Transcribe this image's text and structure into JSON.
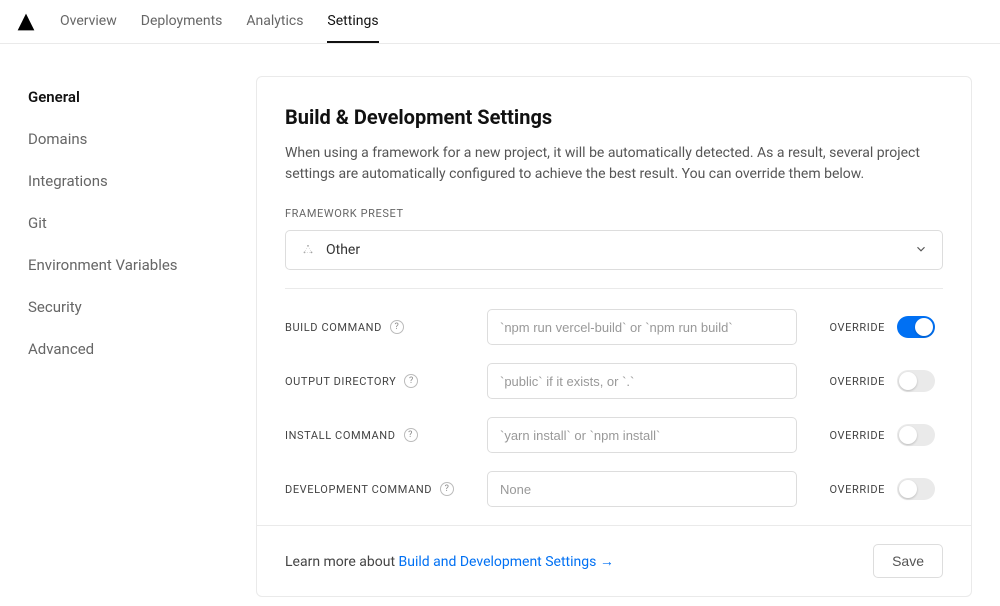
{
  "nav": {
    "items": [
      {
        "label": "Overview"
      },
      {
        "label": "Deployments"
      },
      {
        "label": "Analytics"
      },
      {
        "label": "Settings"
      }
    ],
    "active_index": 3
  },
  "sidebar": {
    "items": [
      {
        "label": "General"
      },
      {
        "label": "Domains"
      },
      {
        "label": "Integrations"
      },
      {
        "label": "Git"
      },
      {
        "label": "Environment Variables"
      },
      {
        "label": "Security"
      },
      {
        "label": "Advanced"
      }
    ],
    "active_index": 0
  },
  "panel": {
    "title": "Build & Development Settings",
    "description": "When using a framework for a new project, it will be automatically detected. As a result, several project settings are automatically configured to achieve the best result. You can override them below.",
    "framework_preset_label": "FRAMEWORK PRESET",
    "framework_preset_value": "Other",
    "override_label": "OVERRIDE",
    "rows": [
      {
        "label": "BUILD COMMAND",
        "placeholder": "`npm run vercel-build` or `npm run build`",
        "value": "",
        "override": true
      },
      {
        "label": "OUTPUT DIRECTORY",
        "placeholder": "`public` if it exists, or `.`",
        "value": "",
        "override": false
      },
      {
        "label": "INSTALL COMMAND",
        "placeholder": "`yarn install` or `npm install`",
        "value": "",
        "override": false
      },
      {
        "label": "DEVELOPMENT COMMAND",
        "placeholder": "None",
        "value": "",
        "override": false
      }
    ],
    "footer_prefix": "Learn more about ",
    "footer_link": "Build and Development Settings →",
    "save_label": "Save"
  }
}
